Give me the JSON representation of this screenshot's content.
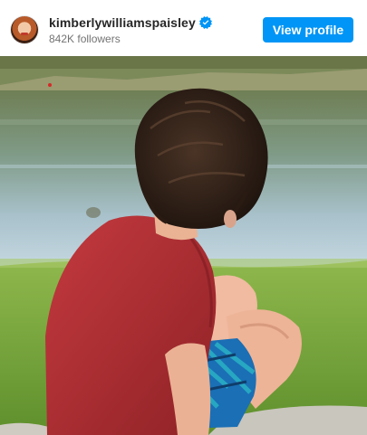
{
  "profile": {
    "username": "kimberlywilliamspaisley",
    "followers": "842K followers",
    "verified": true,
    "avatar_icon": "profile-avatar"
  },
  "actions": {
    "view_profile_label": "View profile"
  },
  "photo": {
    "subject": "child-sitting-by-pond",
    "icon": "photo"
  },
  "colors": {
    "accent": "#0095f6",
    "text_primary": "#262626",
    "text_secondary": "#737373",
    "verified_badge": "#0095f6"
  }
}
